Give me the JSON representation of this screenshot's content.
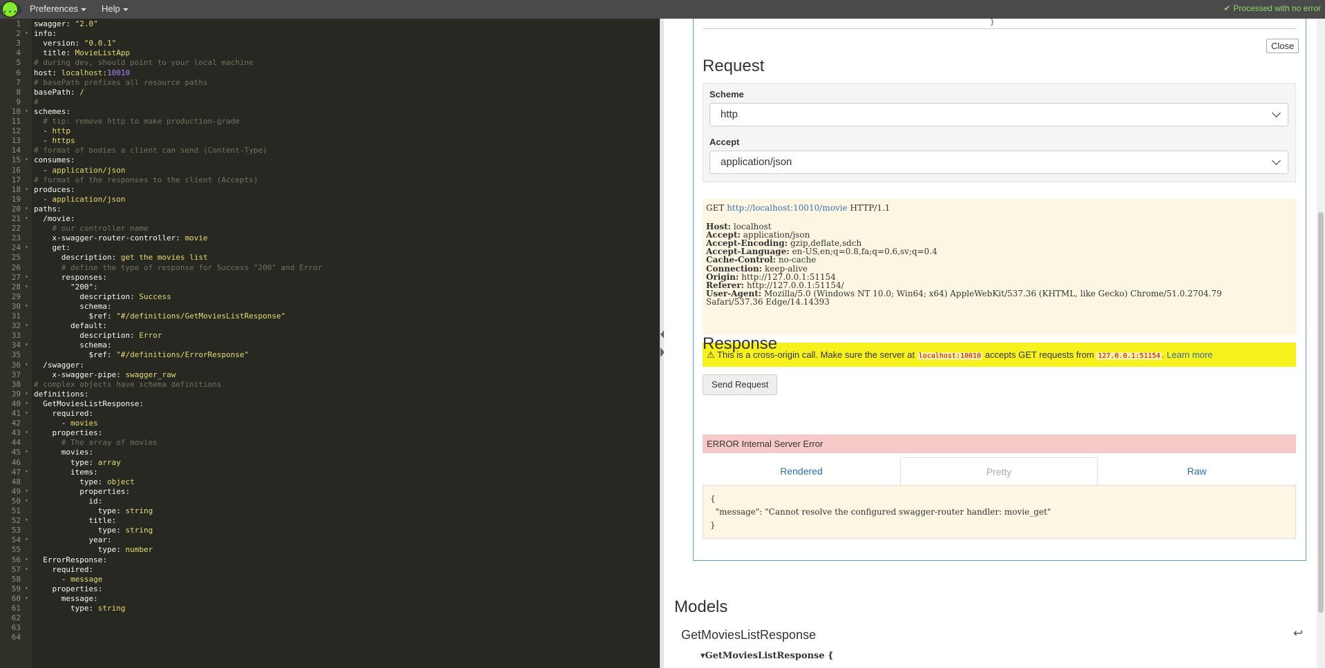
{
  "topbar": {
    "logo_text": "{...}",
    "menu_preferences": "Preferences",
    "menu_help": "Help",
    "status_icon": "check-icon",
    "status_check": "✔",
    "status_text": "Processed with no error"
  },
  "editor": {
    "lines": [
      {
        "n": "1",
        "text": "swagger: \"2.0\"",
        "fold": false
      },
      {
        "n": "2",
        "text": "info:",
        "fold": true
      },
      {
        "n": "3",
        "text": "  version: \"0.0.1\"",
        "fold": false
      },
      {
        "n": "4",
        "text": "  title: MovieListApp",
        "fold": false
      },
      {
        "n": "5",
        "text": "# during dev, should point to your local machine",
        "fold": false
      },
      {
        "n": "6",
        "text": "host: localhost:10010",
        "fold": false
      },
      {
        "n": "7",
        "text": "# basePath prefixes all resource paths",
        "fold": false
      },
      {
        "n": "8",
        "text": "basePath: /",
        "fold": false
      },
      {
        "n": "9",
        "text": "#",
        "fold": false
      },
      {
        "n": "10",
        "text": "schemes:",
        "fold": true
      },
      {
        "n": "11",
        "text": "  # tip: remove http to make production-grade",
        "fold": false
      },
      {
        "n": "12",
        "text": "  - http",
        "fold": false
      },
      {
        "n": "13",
        "text": "  - https",
        "fold": false
      },
      {
        "n": "14",
        "text": "# format of bodies a client can send (Content-Type)",
        "fold": false
      },
      {
        "n": "15",
        "text": "consumes:",
        "fold": true
      },
      {
        "n": "16",
        "text": "  - application/json",
        "fold": false
      },
      {
        "n": "17",
        "text": "# format of the responses to the client (Accepts)",
        "fold": false
      },
      {
        "n": "18",
        "text": "produces:",
        "fold": true
      },
      {
        "n": "19",
        "text": "  - application/json",
        "fold": false
      },
      {
        "n": "20",
        "text": "paths:",
        "fold": true
      },
      {
        "n": "21",
        "text": "  /movie:",
        "fold": true
      },
      {
        "n": "22",
        "text": "    # our controller name",
        "fold": false
      },
      {
        "n": "23",
        "text": "    x-swagger-router-controller: movie",
        "fold": false
      },
      {
        "n": "24",
        "text": "    get:",
        "fold": true
      },
      {
        "n": "25",
        "text": "      description: get the movies list",
        "fold": false
      },
      {
        "n": "26",
        "text": "      # define the type of response for Success \"200\" and Error",
        "fold": false
      },
      {
        "n": "27",
        "text": "      responses:",
        "fold": true
      },
      {
        "n": "28",
        "text": "        \"200\":",
        "fold": true
      },
      {
        "n": "29",
        "text": "          description: Success",
        "fold": false
      },
      {
        "n": "30",
        "text": "          schema:",
        "fold": true
      },
      {
        "n": "31",
        "text": "            $ref: \"#/definitions/GetMoviesListResponse\"",
        "fold": false
      },
      {
        "n": "32",
        "text": "        default:",
        "fold": true
      },
      {
        "n": "33",
        "text": "          description: Error",
        "fold": false
      },
      {
        "n": "34",
        "text": "          schema:",
        "fold": true
      },
      {
        "n": "35",
        "text": "            $ref: \"#/definitions/ErrorResponse\"",
        "fold": false
      },
      {
        "n": "36",
        "text": "  /swagger:",
        "fold": true
      },
      {
        "n": "37",
        "text": "    x-swagger-pipe: swagger_raw",
        "fold": false
      },
      {
        "n": "38",
        "text": "# complex objects have schema definitions",
        "fold": false
      },
      {
        "n": "39",
        "text": "definitions:",
        "fold": true
      },
      {
        "n": "40",
        "text": "  GetMoviesListResponse:",
        "fold": true
      },
      {
        "n": "41",
        "text": "    required:",
        "fold": true
      },
      {
        "n": "42",
        "text": "      - movies",
        "fold": false
      },
      {
        "n": "43",
        "text": "    properties:",
        "fold": true
      },
      {
        "n": "44",
        "text": "      # The array of movies",
        "fold": false
      },
      {
        "n": "45",
        "text": "      movies:",
        "fold": true
      },
      {
        "n": "46",
        "text": "        type: array",
        "fold": false
      },
      {
        "n": "47",
        "text": "        items:",
        "fold": true
      },
      {
        "n": "48",
        "text": "          type: object",
        "fold": false
      },
      {
        "n": "49",
        "text": "          properties:",
        "fold": true
      },
      {
        "n": "50",
        "text": "            id:",
        "fold": true
      },
      {
        "n": "51",
        "text": "              type: string",
        "fold": false
      },
      {
        "n": "52",
        "text": "            title:",
        "fold": true
      },
      {
        "n": "53",
        "text": "              type: string",
        "fold": false
      },
      {
        "n": "54",
        "text": "            year:",
        "fold": true
      },
      {
        "n": "55",
        "text": "              type: number",
        "fold": false
      },
      {
        "n": "56",
        "text": "  ErrorResponse:",
        "fold": true
      },
      {
        "n": "57",
        "text": "    required:",
        "fold": true
      },
      {
        "n": "58",
        "text": "      - message",
        "fold": false
      },
      {
        "n": "59",
        "text": "    properties:",
        "fold": true
      },
      {
        "n": "60",
        "text": "      message:",
        "fold": true
      },
      {
        "n": "61",
        "text": "        type: string",
        "fold": false
      },
      {
        "n": "62",
        "text": "",
        "fold": false
      },
      {
        "n": "63",
        "text": "",
        "fold": false
      },
      {
        "n": "64",
        "text": "",
        "fold": false
      }
    ]
  },
  "preview": {
    "top_brace": "}",
    "close_label": "Close",
    "request_title": "Request",
    "scheme_label": "Scheme",
    "scheme_value": "http",
    "accept_label": "Accept",
    "accept_value": "application/json",
    "request_line": {
      "method": "GET",
      "url": "http://localhost:10010/movie",
      "protocol": "HTTP/1.1"
    },
    "headers": [
      {
        "name": "Host:",
        "value": "localhost"
      },
      {
        "name": "Accept:",
        "value": "application/json"
      },
      {
        "name": "Accept-Encoding:",
        "value": "gzip,deflate,sdch"
      },
      {
        "name": "Accept-Language:",
        "value": "en-US,en;q=0.8,fa;q=0.6,sv;q=0.4"
      },
      {
        "name": "Cache-Control:",
        "value": "no-cache"
      },
      {
        "name": "Connection:",
        "value": "keep-alive"
      },
      {
        "name": "Origin:",
        "value": "http://127.0.0.1:51154"
      },
      {
        "name": "Referer:",
        "value": "http://127.0.0.1:51154/"
      },
      {
        "name": "User-Agent:",
        "value": "Mozilla/5.0 (Windows NT 10.0; Win64; x64) AppleWebKit/537.36 (KHTML, like Gecko) Chrome/51.0.2704.79"
      }
    ],
    "user_agent_cont": "Safari/537.36 Edge/14.14393",
    "warning": {
      "icon": "warning-icon",
      "glyph": "⚠",
      "text1": "This is a cross-origin call. Make sure the server at",
      "server": "localhost:10010",
      "text2": "accepts GET requests from",
      "origin": "127.0.0.1:51154",
      "text3": ".",
      "learn_more": "Learn more"
    },
    "send_label": "Send Request",
    "response_title": "Response",
    "error_text": "ERROR Internal Server Error",
    "tabs": [
      "Rendered",
      "Pretty",
      "Raw"
    ],
    "active_tab": "Pretty",
    "response_body": [
      "{",
      "  \"message\": \"Cannot resolve the configured swagger-router handler: movie_get\"",
      "}"
    ],
    "models_title": "Models",
    "model_name": "GetMoviesListResponse",
    "model_back_icon": "reply-arrow-icon",
    "model_sub_glyph": "▾",
    "model_sub": "GetMoviesListResponse {"
  }
}
